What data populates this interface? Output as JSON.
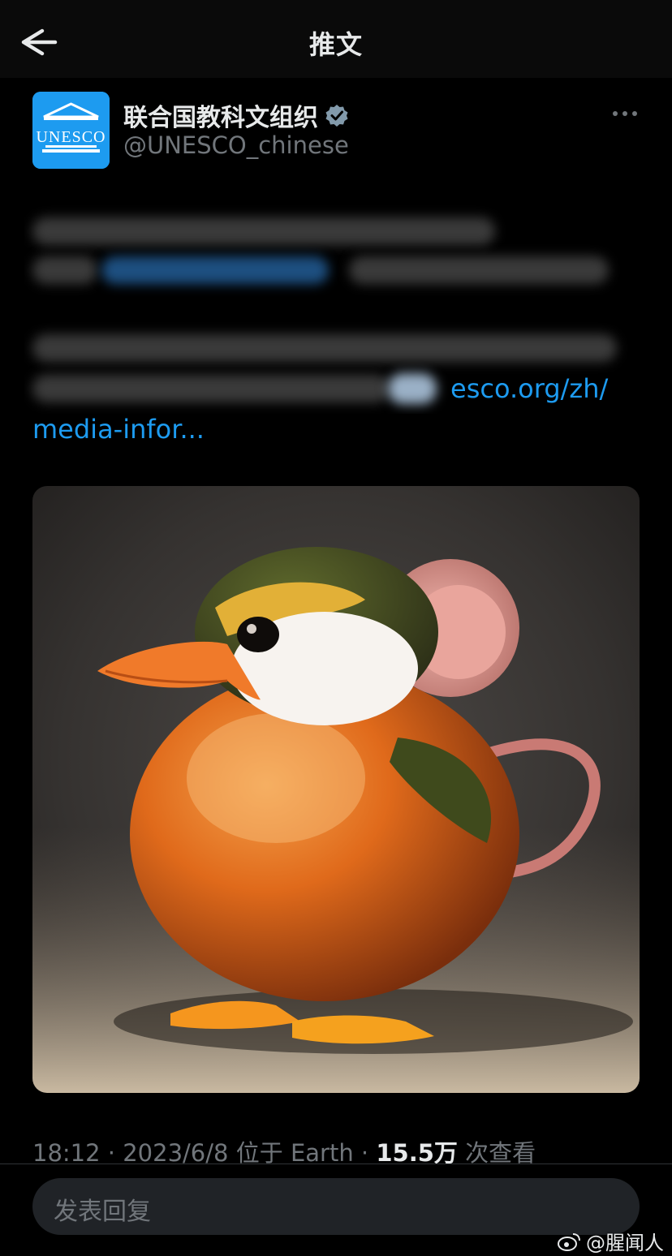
{
  "header": {
    "title": "推文"
  },
  "author": {
    "avatar_text": "UNESCO",
    "display_name": "联合国教科文组织",
    "handle": "@UNESCO_chinese"
  },
  "tweet": {
    "link_line1": "esco.org/zh/",
    "link_line2": "media-infor..."
  },
  "meta": {
    "time": "18:12",
    "date": "2023/6/8",
    "location_prefix": "位于",
    "location": "Earth",
    "views": "15.5万",
    "views_suffix": "次查看"
  },
  "reply": {
    "placeholder": "发表回复"
  },
  "watermark": {
    "text": "@腥闻人"
  },
  "colors": {
    "accent": "#1d9bf0",
    "muted": "#71767b",
    "text": "#e7e9ea"
  },
  "icons": [
    "back-arrow-icon",
    "verified-badge-icon",
    "more-icon",
    "weibo-icon"
  ]
}
